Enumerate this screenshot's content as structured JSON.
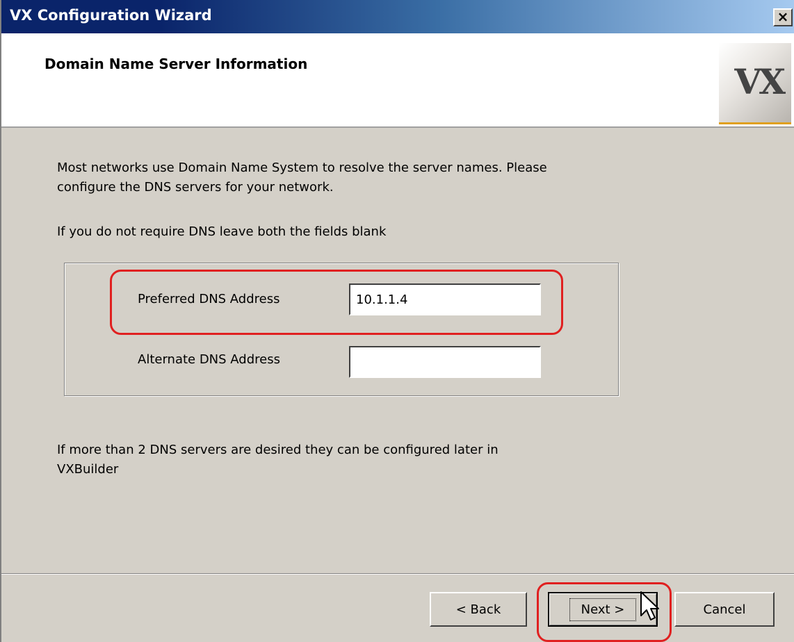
{
  "window": {
    "title": "VX Configuration Wizard",
    "close_label": "×"
  },
  "header": {
    "title": "Domain Name Server Information",
    "logo_text": "VX"
  },
  "body": {
    "intro_line1": "Most networks use Domain Name System to resolve the server names. Please",
    "intro_line2": "configure the DNS servers for your network.",
    "blank_note": "If you do not require DNS leave both the fields blank",
    "later_line1": "If more than 2 DNS servers are desired they can be configured later in",
    "later_line2": "VXBuilder"
  },
  "dns": {
    "preferred_label": "Preferred DNS Address",
    "preferred_value": "10.1.1.4",
    "alternate_label": "Alternate DNS Address",
    "alternate_value": ""
  },
  "buttons": {
    "back": "< Back",
    "next": "Next >",
    "cancel": "Cancel"
  },
  "colors": {
    "titlebar_start": "#0a246a",
    "titlebar_end": "#a6caf0",
    "dialog_bg": "#d4d0c8",
    "highlight": "#e02020"
  }
}
